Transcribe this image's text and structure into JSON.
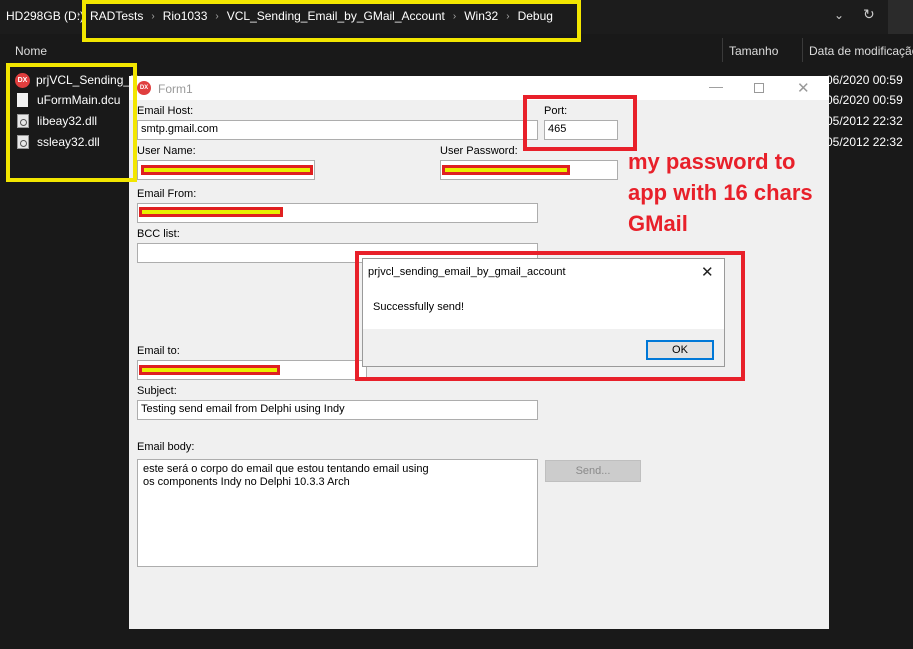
{
  "explorer": {
    "drive": "HD298GB (D:)",
    "breadcrumbs": [
      "RADTests",
      "Rio1033",
      "VCL_Sending_Email_by_GMail_Account",
      "Win32",
      "Debug"
    ],
    "columns": {
      "name": "Nome",
      "size": "Tamanho",
      "date": "Data de modificação"
    },
    "files": [
      {
        "name": "prjVCL_Sending_E",
        "icon": "delphi-exe-icon",
        "date": "06/2020 00:59"
      },
      {
        "name": "uFormMain.dcu",
        "icon": "file-icon",
        "date": "06/2020 00:59"
      },
      {
        "name": "libeay32.dll",
        "icon": "dll-icon",
        "date": "05/2012 22:32"
      },
      {
        "name": "ssleay32.dll",
        "icon": "dll-icon",
        "date": "05/2012 22:32"
      }
    ]
  },
  "form": {
    "title": "Form1",
    "icon_text": "DX",
    "email_host": {
      "label": "Email Host:",
      "value": "smtp.gmail.com"
    },
    "port": {
      "label": "Port:",
      "value": "465"
    },
    "user_name": {
      "label": "User Name:"
    },
    "user_password": {
      "label": "User Password:"
    },
    "email_from": {
      "label": "Email From:"
    },
    "bcc": {
      "label": "BCC list:"
    },
    "email_to": {
      "label": "Email to:"
    },
    "subject": {
      "label": "Subject:",
      "value": "Testing send email from Delphi using Indy"
    },
    "body": {
      "label": "Email body:",
      "lines": [
        "este será o corpo do email que estou tentando email using",
        "os components Indy no Delphi 10.3.3 Arch"
      ]
    },
    "send_label": "Send..."
  },
  "dialog": {
    "title": "prjvcl_sending_email_by_gmail_account",
    "message": "Successfully send!",
    "ok_label": "OK"
  },
  "annotation": {
    "lines": [
      "my password to",
      "app with 16 chars",
      "GMail"
    ],
    "highlight_yellow": "#f2e600",
    "highlight_red": "#e8202a"
  }
}
